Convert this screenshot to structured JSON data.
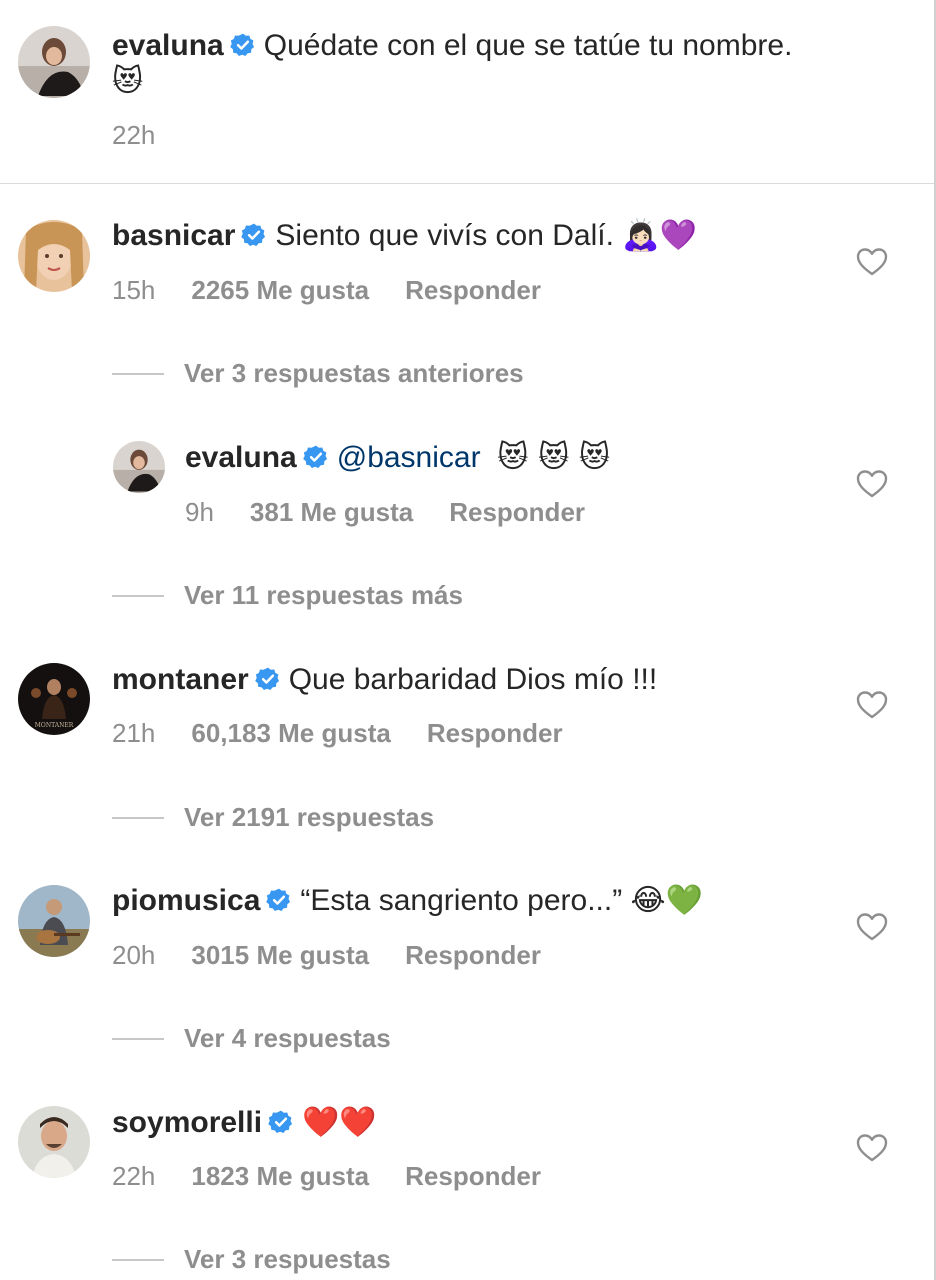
{
  "caption": {
    "username": "evaluna",
    "text": "Quédate con el que se tatúe tu nombre.",
    "emoji": "😻",
    "time": "22h"
  },
  "comments": [
    {
      "username": "basnicar",
      "text": "Siento que vivís con Dalí.",
      "emoji": "🙇🏻‍♀️💜",
      "time": "15h",
      "likes": "2265 Me gusta",
      "reply": "Responder",
      "view_replies": "Ver 3 respuestas anteriores",
      "nested_reply": {
        "username": "evaluna",
        "mention": "@basnicar",
        "emoji": "😻 😻 😻",
        "time": "9h",
        "likes": "381 Me gusta",
        "reply": "Responder"
      },
      "more_replies": "Ver 11 respuestas más"
    },
    {
      "username": "montaner",
      "text": "Que barbaridad Dios mío !!!",
      "emoji": "",
      "time": "21h",
      "likes": "60,183 Me gusta",
      "reply": "Responder",
      "view_replies": "Ver 2191 respuestas",
      "avatar_text": "MONTANER"
    },
    {
      "username": "piomusica",
      "text": "“Esta sangriento pero...”",
      "emoji": "😂💚",
      "time": "20h",
      "likes": "3015 Me gusta",
      "reply": "Responder",
      "view_replies": "Ver 4 respuestas"
    },
    {
      "username": "soymorelli",
      "text": "",
      "emoji": "❤️❤️",
      "time": "22h",
      "likes": "1823 Me gusta",
      "reply": "Responder",
      "view_replies": "Ver 3 respuestas"
    }
  ],
  "colors": {
    "verified": "#3897f0",
    "secondary_text": "#8e8e8e",
    "mention": "#00376b"
  }
}
